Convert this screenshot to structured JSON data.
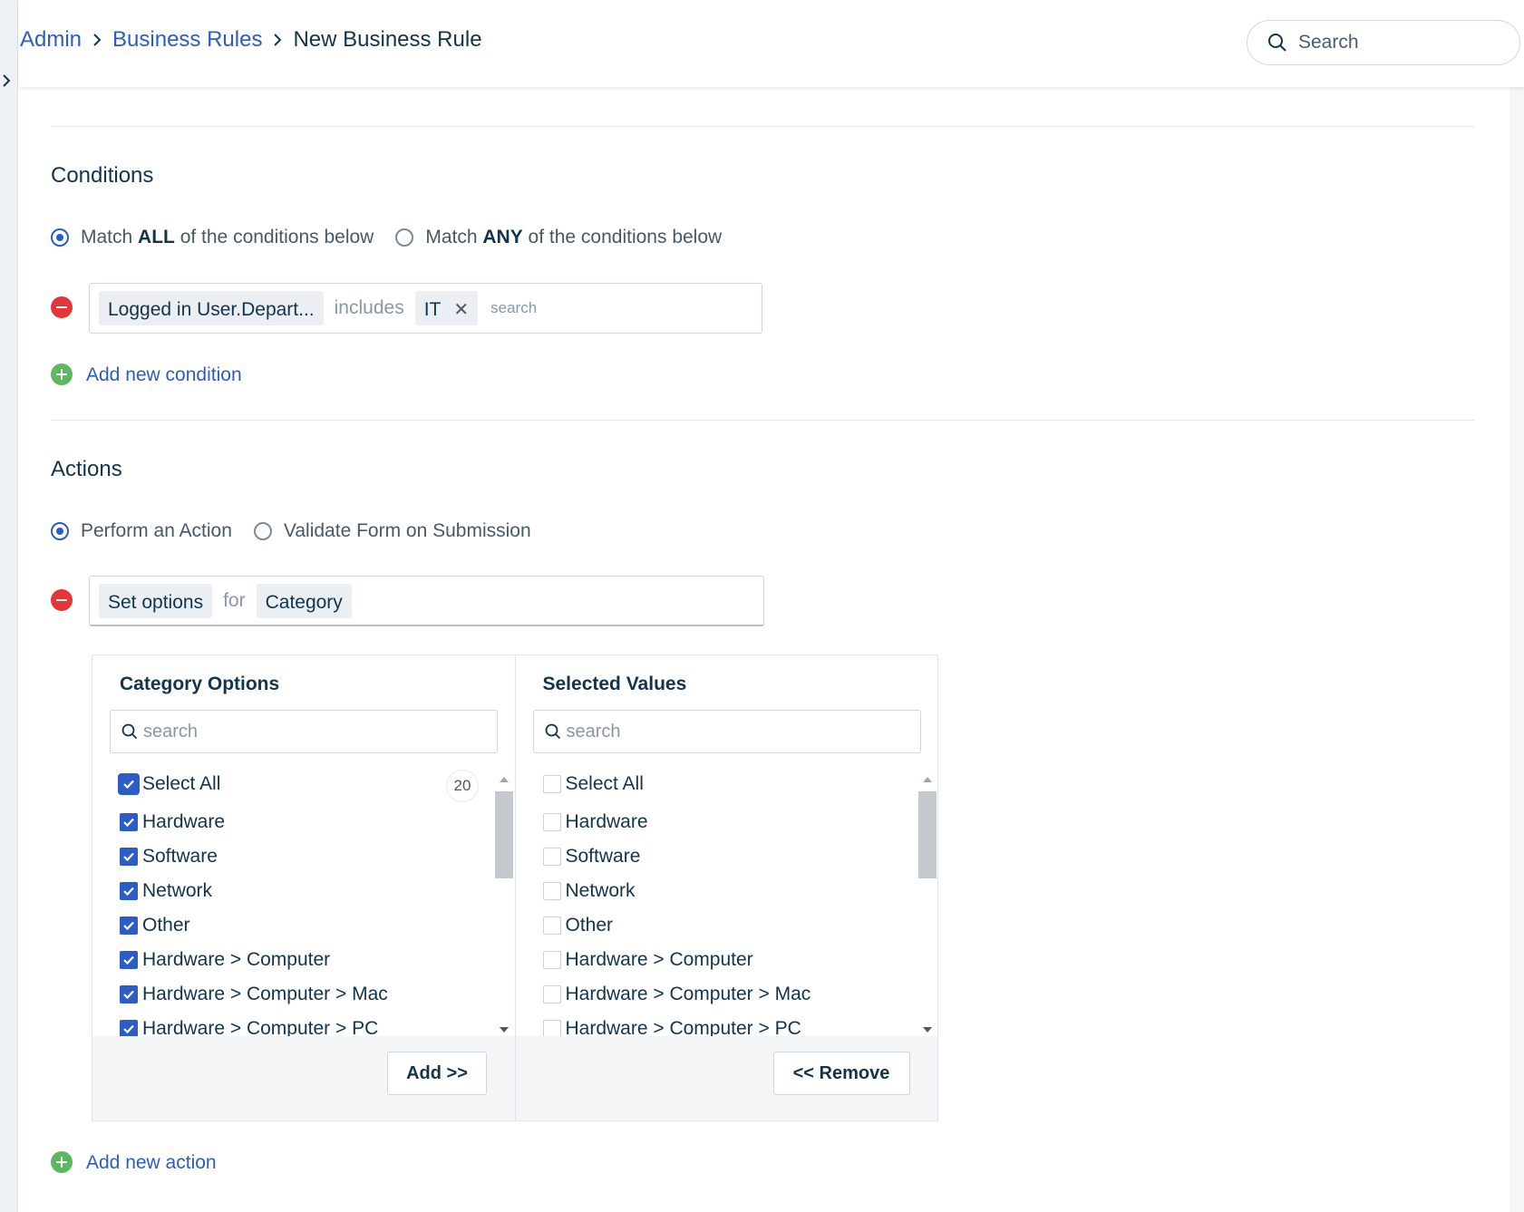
{
  "breadcrumb": {
    "items": [
      "Admin",
      "Business Rules"
    ],
    "current": "New Business Rule"
  },
  "search": {
    "placeholder": "Search"
  },
  "conditions": {
    "title": "Conditions",
    "match_options": [
      {
        "prefix": "Match ",
        "keyword": "ALL",
        "suffix": " of the conditions below",
        "selected": true
      },
      {
        "prefix": "Match ",
        "keyword": "ANY",
        "suffix": " of the conditions below",
        "selected": false
      }
    ],
    "rule": {
      "field": "Logged in User.Depart...",
      "operator": "includes",
      "value": "IT",
      "search_placeholder": "search"
    },
    "add_label": "Add new condition"
  },
  "actions": {
    "title": "Actions",
    "mode_options": [
      {
        "label": "Perform an Action",
        "selected": true
      },
      {
        "label": "Validate Form on Submission",
        "selected": false
      }
    ],
    "rule": {
      "action": "Set options",
      "connector": "for",
      "target": "Category"
    },
    "add_label": "Add new action"
  },
  "dual_list": {
    "left": {
      "title": "Category Options",
      "search_placeholder": "search",
      "select_all_label": "Select All",
      "count": "20",
      "items": [
        {
          "label": "Hardware",
          "checked": true
        },
        {
          "label": "Software",
          "checked": true
        },
        {
          "label": "Network",
          "checked": true
        },
        {
          "label": "Other",
          "checked": true
        },
        {
          "label": "Hardware > Computer",
          "checked": true
        },
        {
          "label": "Hardware > Computer > Mac",
          "checked": true
        },
        {
          "label": "Hardware > Computer > PC",
          "checked": true
        }
      ],
      "button": "Add >>"
    },
    "right": {
      "title": "Selected Values",
      "search_placeholder": "search",
      "select_all_label": "Select All",
      "items": [
        {
          "label": "Hardware",
          "checked": false
        },
        {
          "label": "Software",
          "checked": false
        },
        {
          "label": "Network",
          "checked": false
        },
        {
          "label": "Other",
          "checked": false
        },
        {
          "label": "Hardware > Computer",
          "checked": false
        },
        {
          "label": "Hardware > Computer > Mac",
          "checked": false
        },
        {
          "label": "Hardware > Computer > PC",
          "checked": false
        }
      ],
      "button": "<< Remove"
    }
  },
  "colors": {
    "accent": "#2c5cc5",
    "danger": "#e43538",
    "success": "#5cb85c"
  }
}
